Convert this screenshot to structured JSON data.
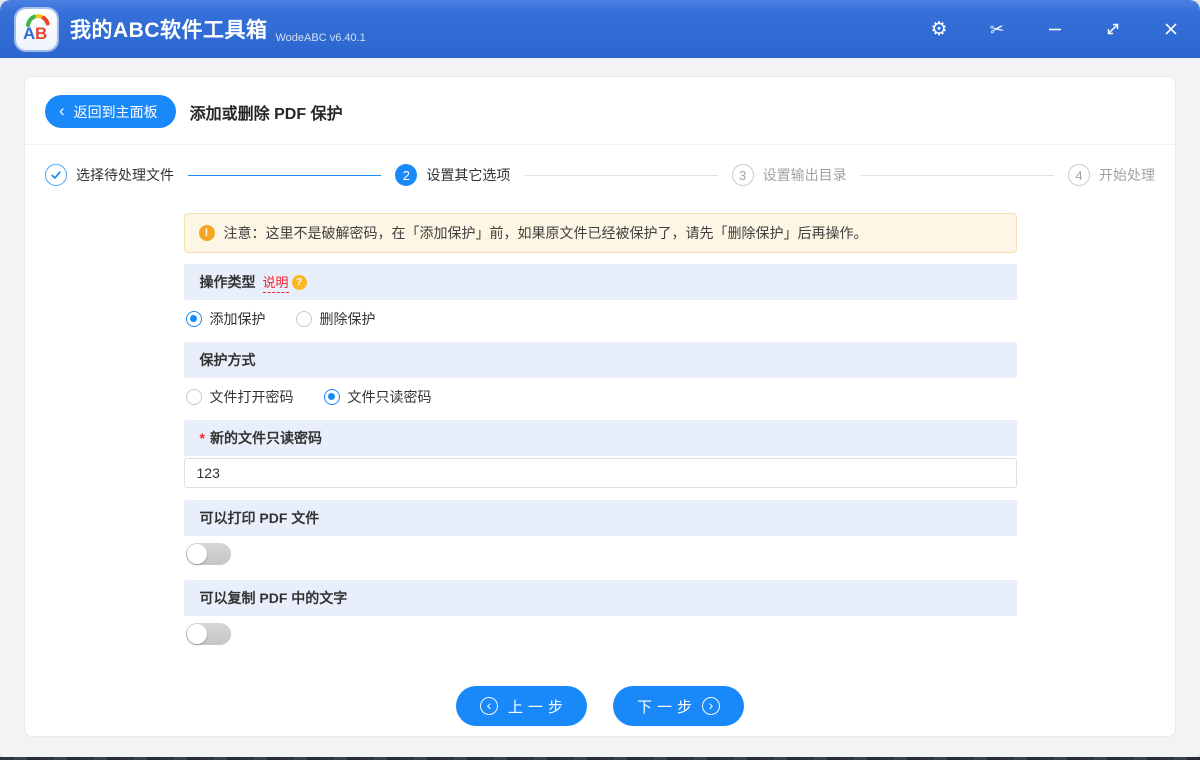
{
  "window": {
    "title": "我的ABC软件工具箱",
    "version": "WodeABC v6.40.1",
    "titlebar_icons": {
      "settings_glyph": "⚙",
      "screenshot_glyph": "✂"
    }
  },
  "header": {
    "back_chevron": "‹",
    "back_label": "返回到主面板",
    "page_title": "添加或删除 PDF 保护"
  },
  "stepper": {
    "steps": [
      {
        "num": "1",
        "label": "选择待处理文件",
        "state": "done"
      },
      {
        "num": "2",
        "label": "设置其它选项",
        "state": "active"
      },
      {
        "num": "3",
        "label": "设置输出目录",
        "state": "pending"
      },
      {
        "num": "4",
        "label": "开始处理",
        "state": "pending"
      }
    ]
  },
  "notice": {
    "icon": "!",
    "text": "注意：这里不是破解密码，在「添加保护」前，如果原文件已经被保护了，请先「删除保护」后再操作。"
  },
  "sections": {
    "operation_type": {
      "title": "操作类型",
      "help_link": "说明",
      "help_icon": "?",
      "options": [
        {
          "label": "添加保护",
          "selected": true
        },
        {
          "label": "删除保护",
          "selected": false
        }
      ]
    },
    "protection_mode": {
      "title": "保护方式",
      "options": [
        {
          "label": "文件打开密码",
          "selected": false
        },
        {
          "label": "文件只读密码",
          "selected": true
        }
      ]
    },
    "password": {
      "required_mark": "*",
      "title": "新的文件只读密码",
      "value": "123"
    },
    "allow_print": {
      "title": "可以打印 PDF 文件",
      "enabled": false
    },
    "allow_copy": {
      "title": "可以复制 PDF 中的文字",
      "enabled": false
    }
  },
  "footer": {
    "prev_label": "上一步",
    "next_label": "下一步",
    "prev_arrow": "‹",
    "next_arrow": "›"
  },
  "colors": {
    "titlebar_blue": "#2f6bd3",
    "accent_blue": "#1989fa",
    "section_header_bg": "#e9eefb",
    "notice_bg": "#fdf6e4",
    "notice_border": "#f1e0ac",
    "warning_orange": "#f5a623",
    "danger_red": "#f5222d"
  }
}
